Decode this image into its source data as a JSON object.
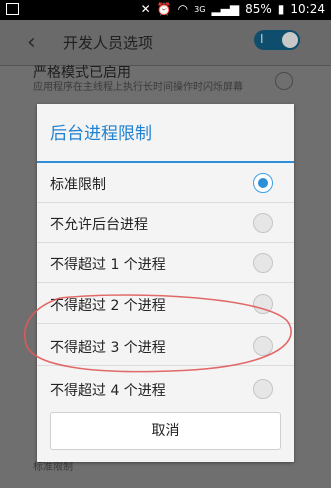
{
  "status": {
    "battery": "85%",
    "time": "10:24",
    "network": "3G"
  },
  "background": {
    "screen_title": "开发人员选项",
    "strict_mode_title": "严格模式已启用",
    "strict_mode_desc": "应用程序在主线程上执行长时间操作时闪烁屏幕",
    "bottom_text": "标准限制",
    "toggle_text": "I"
  },
  "dialog": {
    "title": "后台进程限制",
    "options": [
      {
        "label": "标准限制",
        "checked": true
      },
      {
        "label": "不允许后台进程",
        "checked": false
      },
      {
        "label": "不得超过 1 个进程",
        "checked": false
      },
      {
        "label": "不得超过 2 个进程",
        "checked": false
      },
      {
        "label": "不得超过 3 个进程",
        "checked": false
      },
      {
        "label": "不得超过 4 个进程",
        "checked": false
      }
    ],
    "cancel": "取消"
  }
}
